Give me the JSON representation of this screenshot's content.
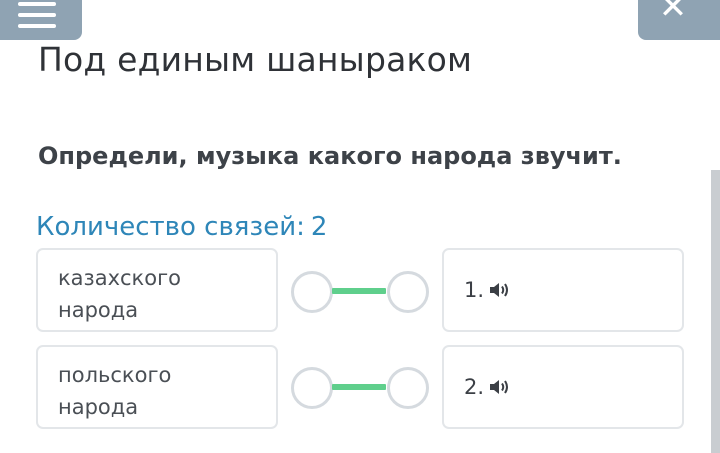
{
  "header": {
    "title": "Под единым шаныраком"
  },
  "question": {
    "text": "Определи, музыка какого народа звучит.",
    "links_label": "Количество связей:",
    "links_count": "2"
  },
  "pairs": [
    {
      "left_label": "казахского народа",
      "right_label": "1.",
      "right_icon": "speaker-icon",
      "connected": true
    },
    {
      "left_label": "польского народа",
      "right_label": "2.",
      "right_icon": "speaker-icon",
      "connected": true
    }
  ],
  "colors": {
    "accent": "#2e86b8",
    "link_line": "#5fcf8c",
    "top_buttons": "#8fa3b3"
  }
}
